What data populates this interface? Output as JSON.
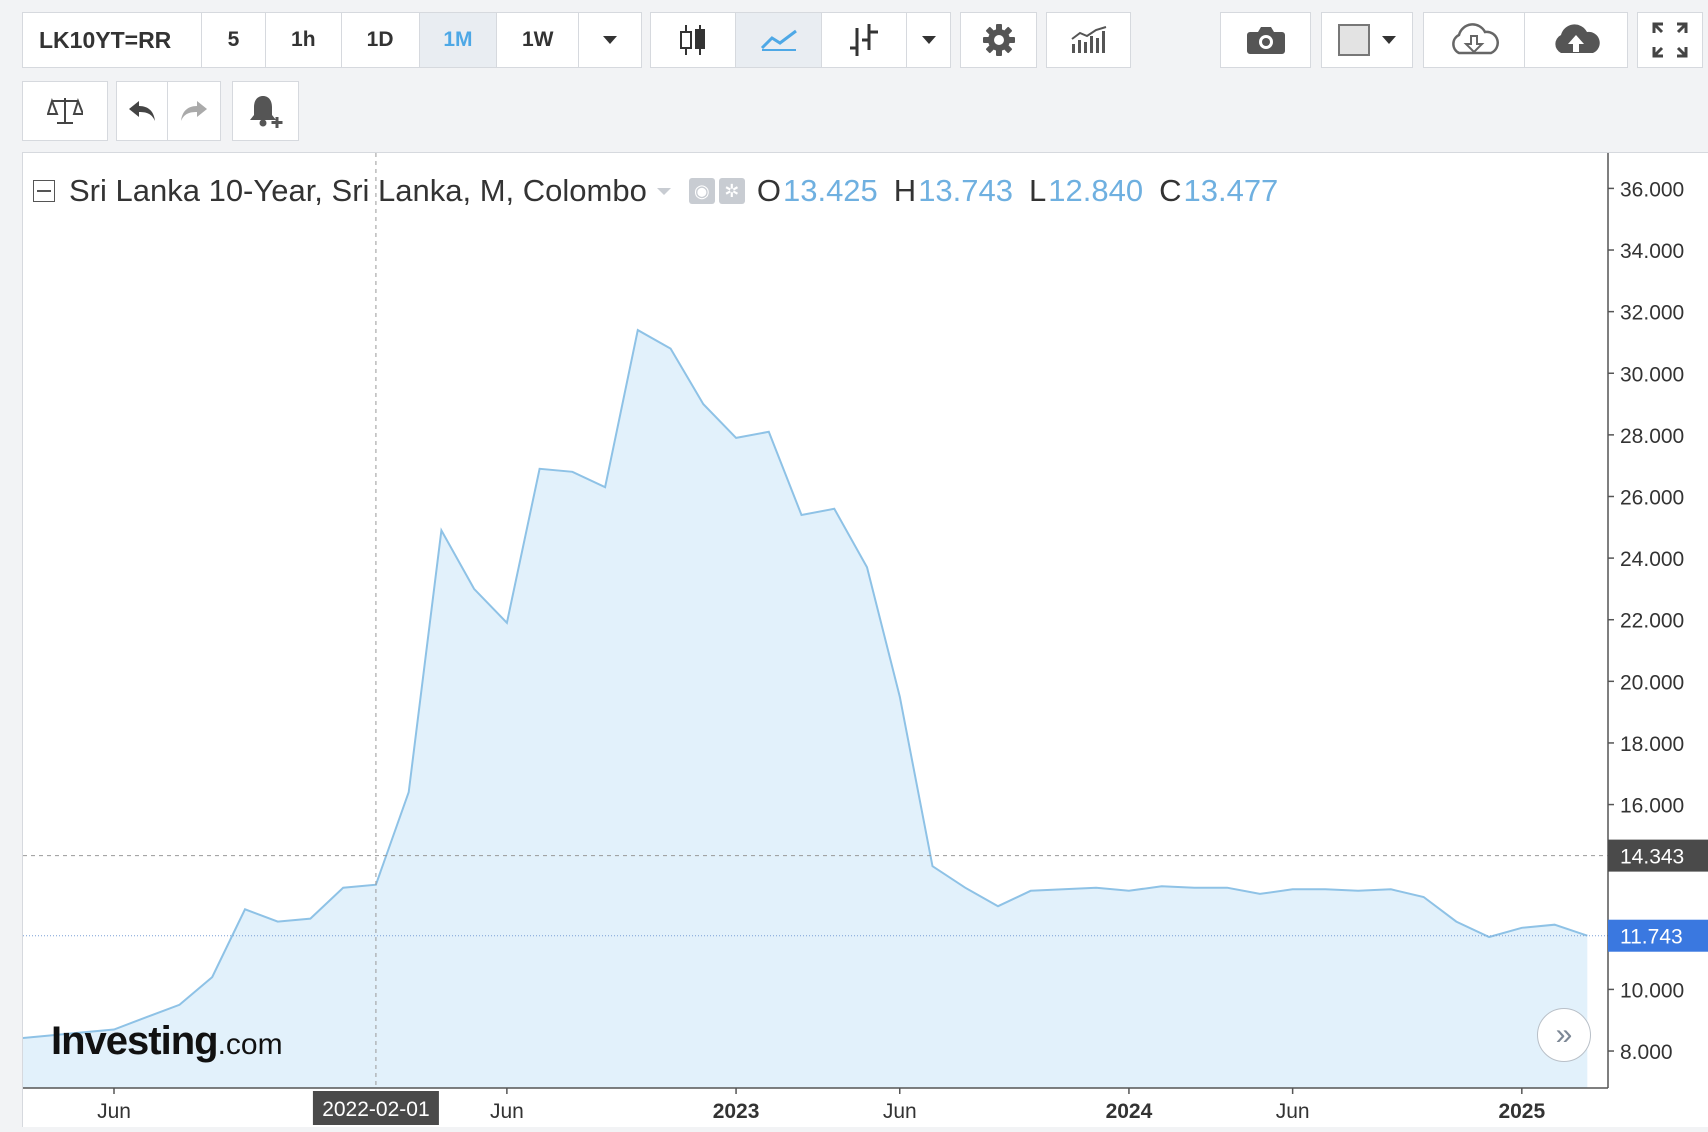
{
  "toolbar": {
    "symbol": "LK10YT=RR",
    "intervals": [
      "5",
      "1h",
      "1D",
      "1M",
      "1W"
    ],
    "active_interval": "1M"
  },
  "legend": {
    "title": "Sri Lanka 10-Year, Sri Lanka, M, Colombo",
    "open_label": "O",
    "open": "13.425",
    "high_label": "H",
    "high": "13.743",
    "low_label": "L",
    "low": "12.840",
    "close_label": "C",
    "close": "13.477"
  },
  "logo": {
    "main": "Investing",
    "suffix": ".com"
  },
  "crosshair": {
    "x_label": "2022-02-01",
    "y_label": "14.343",
    "x_date": "2022-02-01",
    "y_value": 14.343
  },
  "last_price": {
    "label": "11.743",
    "value": 11.743
  },
  "colors": {
    "line": "#8ec2e6",
    "fill": "#e2f1fb",
    "accent": "#4ea8e6",
    "last_price_bg": "#3a78e0",
    "crosshair_bg": "#4a4a4a"
  },
  "chart_data": {
    "type": "area",
    "y_ticks": [
      "36.000",
      "34.000",
      "32.000",
      "30.000",
      "28.000",
      "26.000",
      "24.000",
      "22.000",
      "20.000",
      "18.000",
      "16.000",
      "10.000",
      "8.000"
    ],
    "x_ticks": [
      "Jun",
      "Jun",
      "2023",
      "Jun",
      "2024",
      "Jun",
      "2025"
    ],
    "ylim": [
      6.8,
      36.5
    ],
    "x": [
      "2021-03",
      "2021-04",
      "2021-05",
      "2021-06",
      "2021-07",
      "2021-08",
      "2021-09",
      "2021-10",
      "2021-11",
      "2021-12",
      "2022-01",
      "2022-02",
      "2022-03",
      "2022-04",
      "2022-05",
      "2022-06",
      "2022-07",
      "2022-08",
      "2022-09",
      "2022-10",
      "2022-11",
      "2022-12",
      "2023-01",
      "2023-02",
      "2023-03",
      "2023-04",
      "2023-05",
      "2023-06",
      "2023-07",
      "2023-08",
      "2023-09",
      "2023-10",
      "2023-11",
      "2023-12",
      "2024-01",
      "2024-02",
      "2024-03",
      "2024-04",
      "2024-05",
      "2024-06",
      "2024-07",
      "2024-08",
      "2024-09",
      "2024-10",
      "2024-11",
      "2024-12",
      "2025-01",
      "2025-02",
      "2025-03"
    ],
    "series": [
      {
        "values": [
          8.4,
          8.5,
          8.6,
          8.7,
          9.1,
          9.5,
          10.4,
          12.6,
          12.2,
          12.3,
          13.3,
          13.4,
          16.4,
          24.9,
          23.0,
          21.9,
          26.9,
          26.8,
          26.3,
          31.4,
          30.8,
          29.0,
          27.9,
          28.1,
          25.4,
          25.6,
          23.7,
          19.5,
          14.0,
          13.3,
          12.7,
          13.2,
          13.25,
          13.3,
          13.2,
          13.35,
          13.3,
          13.3,
          13.1,
          13.25,
          13.25,
          13.2,
          13.25,
          13.0,
          12.2,
          11.7,
          12.0,
          12.1,
          11.743
        ]
      }
    ]
  }
}
